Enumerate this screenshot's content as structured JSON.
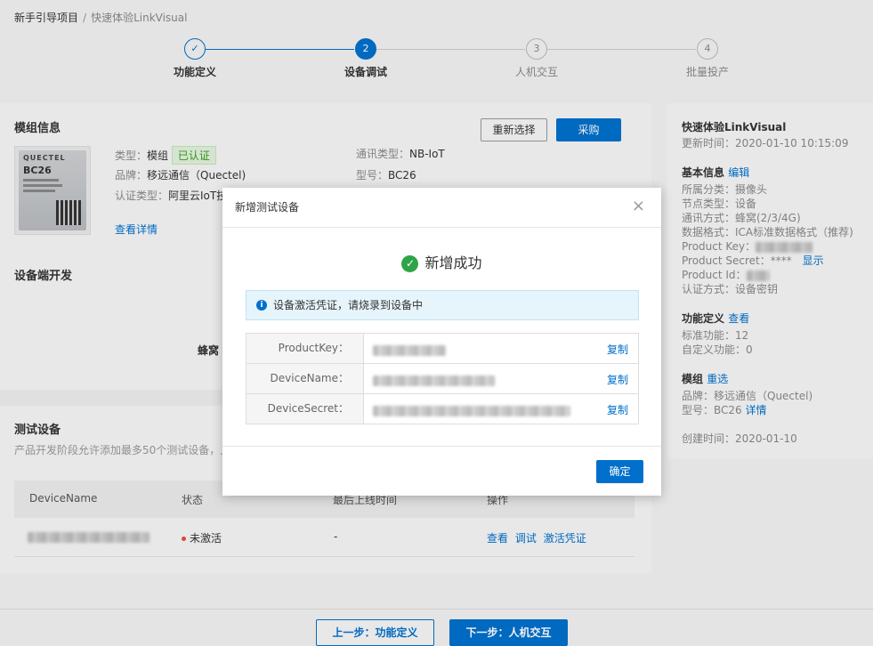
{
  "breadcrumb": {
    "root": "新手引导项目",
    "separator": "/",
    "current": "快速体验LinkVisual"
  },
  "steps": [
    {
      "num": "✓",
      "label": "功能定义",
      "state": "done"
    },
    {
      "num": "2",
      "label": "设备调试",
      "state": "active"
    },
    {
      "num": "3",
      "label": "人机交互",
      "state": "todo"
    },
    {
      "num": "4",
      "label": "批量投产",
      "state": "todo"
    }
  ],
  "module": {
    "title": "模组信息",
    "reselect": "重新选择",
    "purchase": "采购",
    "chip_brand": "QUECTEL",
    "chip_model": "BC26",
    "type_label": "类型：",
    "type_value": "模组",
    "certified": "已认证",
    "brand_label": "品牌：",
    "brand_value": "移远通信（Quectel)",
    "cert_label": "认证类型：",
    "cert_value": "阿里云IoT技",
    "comm_label": "通讯类型：",
    "comm_value": "NB-IoT",
    "model_label": "型号：",
    "model_value": "BC26",
    "details": "查看详情"
  },
  "device_dev": {
    "title": "设备端开发",
    "partial": "蜂窝"
  },
  "test_devices": {
    "title": "测试设备",
    "desc": "产品开发阶段允许添加最多50个测试设备，上",
    "columns": [
      "DeviceName",
      "状态",
      "最后上线时间",
      "操作"
    ],
    "row": {
      "status": "未激活",
      "last_online": "-",
      "actions": [
        "查看",
        "调试",
        "激活凭证"
      ]
    }
  },
  "right": {
    "title": "快速体验LinkVisual",
    "updated": "更新时间：2020-01-10 10:15:09",
    "basic_title": "基本信息",
    "edit": "编辑",
    "category": "所属分类：摄像头",
    "node_type": "节点类型：设备",
    "comm": "通讯方式：蜂窝(2/3/4G)",
    "data_format": "数据格式：ICA标准数据格式（推荐)",
    "product_key": "Product Key：",
    "product_secret": "Product Secret：****",
    "show": "显示",
    "product_id": "Product Id：",
    "auth": "认证方式：设备密钥",
    "func_title": "功能定义",
    "view": "查看",
    "std_func": "标准功能：12",
    "custom_func": "自定义功能：0",
    "module_title": "模组",
    "reselect": "重选",
    "brand": "品牌：移远通信（Quectel)",
    "model": "型号：BC26",
    "detail": "详情",
    "created": "创建时间：2020-01-10"
  },
  "footer": {
    "prev": "上一步：功能定义",
    "next": "下一步：人机交互"
  },
  "dialog": {
    "title": "新增测试设备",
    "close": "×",
    "success": "新增成功",
    "alert": "设备激活凭证，请烧录到设备中",
    "rows": [
      {
        "key": "ProductKey：",
        "copy": "复制"
      },
      {
        "key": "DeviceName：",
        "copy": "复制"
      },
      {
        "key": "DeviceSecret：",
        "copy": "复制"
      }
    ],
    "confirm": "确定"
  },
  "colors": {
    "primary": "#0070cc",
    "success": "#2ea448",
    "danger": "#e84c3d"
  }
}
